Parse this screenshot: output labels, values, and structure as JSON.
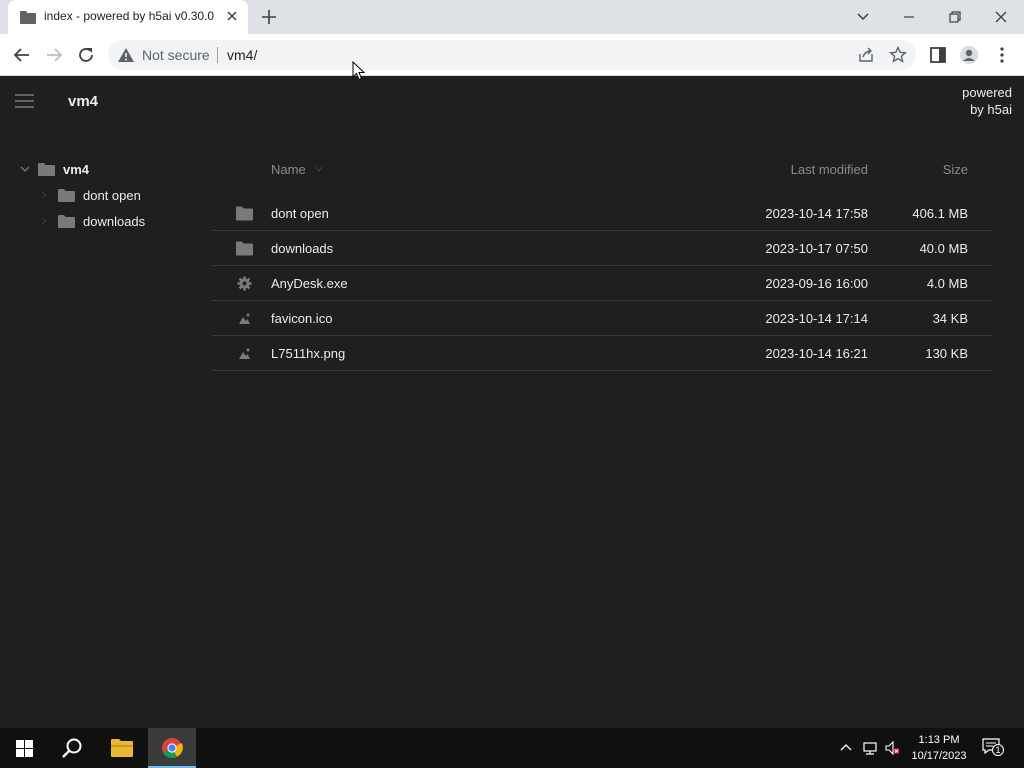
{
  "browser": {
    "tab_title": "index - powered by h5ai v0.30.0",
    "security_text": "Not secure",
    "url": "vm4/"
  },
  "header": {
    "breadcrumb": "vm4",
    "powered_line1": "powered",
    "powered_line2": "by h5ai"
  },
  "tree": {
    "root": "vm4",
    "items": [
      {
        "label": "dont open"
      },
      {
        "label": "downloads"
      }
    ]
  },
  "list": {
    "columns": {
      "name": "Name",
      "modified": "Last modified",
      "size": "Size"
    },
    "rows": [
      {
        "icon": "folder-icon",
        "name": "dont open",
        "modified": "2023-10-14 17:58",
        "size": "406.1 MB"
      },
      {
        "icon": "folder-icon",
        "name": "downloads",
        "modified": "2023-10-17 07:50",
        "size": "40.0 MB"
      },
      {
        "icon": "gear-icon",
        "name": "AnyDesk.exe",
        "modified": "2023-09-16 16:00",
        "size": "4.0 MB"
      },
      {
        "icon": "image-icon",
        "name": "favicon.ico",
        "modified": "2023-10-14 17:14",
        "size": "34 KB"
      },
      {
        "icon": "image-icon",
        "name": "L7511hx.png",
        "modified": "2023-10-14 16:21",
        "size": "130 KB"
      }
    ]
  },
  "taskbar": {
    "time": "1:13 PM",
    "date": "10/17/2023",
    "notification_count": "1"
  },
  "colors": {
    "page_bg": "#1f1f1f",
    "text": "#ececec",
    "muted": "#8a8a8a",
    "icon": "#7a7a7a"
  }
}
